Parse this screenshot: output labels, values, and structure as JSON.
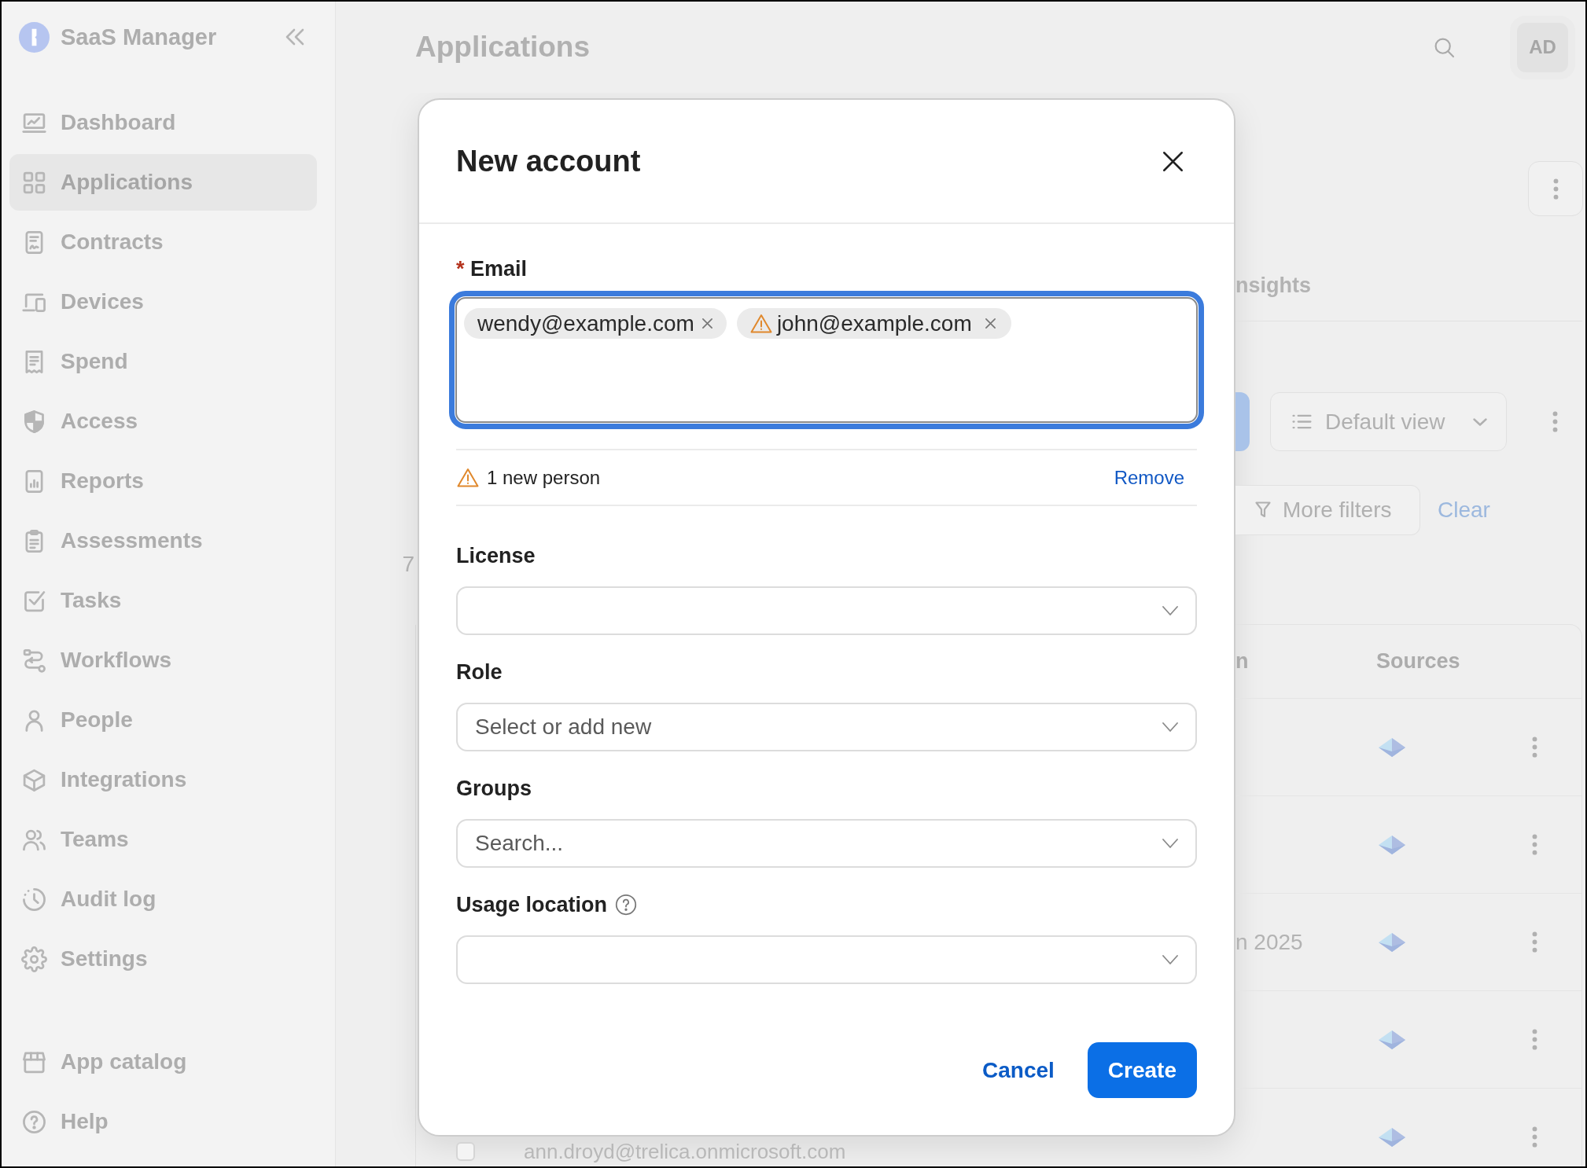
{
  "sidebar": {
    "brand": "SaaS Manager",
    "items": [
      {
        "label": "Dashboard",
        "selected": false
      },
      {
        "label": "Applications",
        "selected": true
      },
      {
        "label": "Contracts",
        "selected": false
      },
      {
        "label": "Devices",
        "selected": false
      },
      {
        "label": "Spend",
        "selected": false
      },
      {
        "label": "Access",
        "selected": false
      },
      {
        "label": "Reports",
        "selected": false
      },
      {
        "label": "Assessments",
        "selected": false
      },
      {
        "label": "Tasks",
        "selected": false
      },
      {
        "label": "Workflows",
        "selected": false
      },
      {
        "label": "People",
        "selected": false
      },
      {
        "label": "Integrations",
        "selected": false
      },
      {
        "label": "Teams",
        "selected": false
      },
      {
        "label": "Audit log",
        "selected": false
      },
      {
        "label": "Settings",
        "selected": false
      }
    ],
    "footer_items": [
      {
        "label": "App catalog",
        "selected": false
      },
      {
        "label": "Help",
        "selected": false
      }
    ]
  },
  "header": {
    "title": "Applications",
    "avatar": "AD"
  },
  "page": {
    "count_fragment": "7",
    "tab": "nsights",
    "view_select": "Default view",
    "more_filters": "More filters",
    "clear": "Clear",
    "table": {
      "columns": [
        "n",
        "Sources"
      ],
      "rows": [
        {},
        {},
        {
          "column_1": "n 2025"
        },
        {},
        {
          "email": "ann.droyd@trelica.onmicrosoft.com",
          "checked": false
        }
      ]
    }
  },
  "modal": {
    "title": "New account",
    "email": {
      "label": "Email",
      "required_mark": "*",
      "focused": true,
      "chips": [
        {
          "label": "wendy@example.com",
          "warning": false
        },
        {
          "label": "john@example.com",
          "warning": true
        }
      ]
    },
    "notice": {
      "text": "1 new person",
      "action": "Remove"
    },
    "fields": [
      {
        "label": "License"
      },
      {
        "label": "Role",
        "placeholder": "Select or add new"
      },
      {
        "label": "Groups",
        "placeholder": "Search..."
      },
      {
        "label": "Usage location",
        "help": true
      }
    ],
    "buttons": [
      {
        "label": "Cancel",
        "kind": "secondary"
      },
      {
        "label": "Create",
        "kind": "primary"
      }
    ]
  }
}
